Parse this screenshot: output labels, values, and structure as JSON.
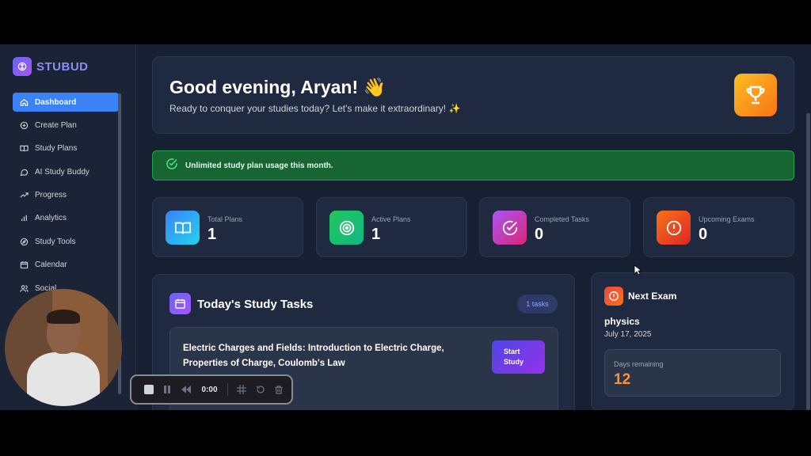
{
  "brand": {
    "name": "STUBUD"
  },
  "sidebar": {
    "items": [
      {
        "label": "Dashboard",
        "icon": "home-icon",
        "active": true
      },
      {
        "label": "Create Plan",
        "icon": "plus-circle-icon"
      },
      {
        "label": "Study Plans",
        "icon": "book-icon"
      },
      {
        "label": "AI Study Buddy",
        "icon": "chat-icon"
      },
      {
        "label": "Progress",
        "icon": "trending-up-icon"
      },
      {
        "label": "Analytics",
        "icon": "bar-chart-icon"
      },
      {
        "label": "Study Tools",
        "icon": "compass-icon"
      },
      {
        "label": "Calendar",
        "icon": "calendar-icon"
      },
      {
        "label": "Social",
        "icon": "users-icon"
      }
    ]
  },
  "greeting": {
    "title": "Good evening, Aryan! 👋",
    "subtitle": "Ready to conquer your studies today? Let's make it extraordinary! ✨"
  },
  "banner": {
    "text": "Unlimited study plan usage this month."
  },
  "stats": [
    {
      "label": "Total Plans",
      "value": "1",
      "icon": "book-open-icon",
      "color": "#38bdf8"
    },
    {
      "label": "Active Plans",
      "value": "1",
      "icon": "target-icon",
      "color": "#22c55e"
    },
    {
      "label": "Completed Tasks",
      "value": "0",
      "icon": "check-circle-icon",
      "color": "#c026d3"
    },
    {
      "label": "Upcoming Exams",
      "value": "0",
      "icon": "alert-circle-icon",
      "color": "#ef4444"
    }
  ],
  "tasks": {
    "title": "Today's Study Tasks",
    "badge": "1 tasks",
    "items": [
      {
        "title": "Electric Charges and Fields: Introduction to Electric Charge, Properties of Charge, Coulomb's Law",
        "button_line1": "Start",
        "button_line2": "Study"
      }
    ]
  },
  "next_exam": {
    "title": "Next Exam",
    "subject": "physics",
    "date": "July 17, 2025",
    "days_label": "Days remaining",
    "days_value": "12"
  },
  "recorder": {
    "time": "0:00"
  }
}
